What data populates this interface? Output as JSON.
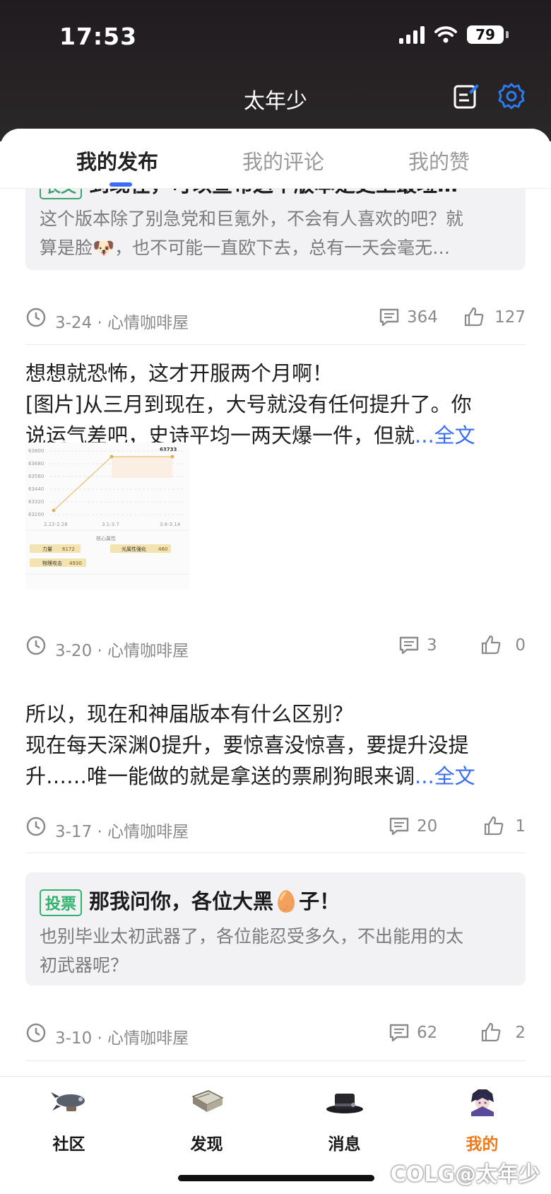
{
  "status_bar": {
    "time": "17:53",
    "battery": "79"
  },
  "header": {
    "title": "太年少"
  },
  "tabs": [
    {
      "label": "我的发布",
      "active": true
    },
    {
      "label": "我的评论",
      "active": false
    },
    {
      "label": "我的赞",
      "active": false
    }
  ],
  "posts": [
    {
      "tag": "长文",
      "title": "到现在，可以宣布这个版本是史上最垃…",
      "body_line1": "这个版本除了别急党和巨氪外，不会有人喜欢的吧？就",
      "body_line2_a": "算是脸",
      "body_line2_b": "，也不可能一直欧下去，总有一天会毫无…",
      "date": "3-24",
      "board": "心情咖啡屋",
      "comments": "364",
      "likes": "127"
    },
    {
      "line1": "想想就恐怖，这才开服两个月啊！",
      "line2": "[图片]从三月到现在，大号就没有任何提升了。你",
      "line3": "说运气差吧，史诗平均一两天爆一件，但就",
      "more": "...全文",
      "date": "3-20",
      "board": "心情咖啡屋",
      "comments": "3",
      "likes": "0",
      "image": {
        "y_ticks": [
          "63800",
          "63680",
          "63560",
          "63440",
          "63320",
          "63200"
        ],
        "x_ticks": [
          "2.22-2.28",
          "3.1-3.7",
          "3.8-3.14"
        ],
        "peak_label": "63733",
        "caption": "核心属性",
        "stats": [
          {
            "name": "力量",
            "value": "6172"
          },
          {
            "name": "光属性强化",
            "value": "460"
          },
          {
            "name": "物理攻击",
            "value": "4930"
          }
        ]
      }
    },
    {
      "line1": "所以，现在和神届版本有什么区别？",
      "line2": "现在每天深渊0提升，要惊喜没惊喜，要提升没提",
      "line3": "升……唯一能做的就是拿送的票刷狗眼来调",
      "more": "...全文",
      "date": "3-17",
      "board": "心情咖啡屋",
      "comments": "20",
      "likes": "1"
    },
    {
      "tag": "投票",
      "title_a": "那我问你，各位大黑",
      "title_b": "子！",
      "body_line1": "也别毕业太初武器了，各位能忍受多久，不出能用的太",
      "body_line2": "初武器呢？",
      "date": "3-10",
      "board": "心情咖啡屋",
      "comments": "62",
      "likes": "2"
    }
  ],
  "bottom_nav": [
    {
      "label": "社区",
      "icon": "airship-icon"
    },
    {
      "label": "发现",
      "icon": "book-icon"
    },
    {
      "label": "消息",
      "icon": "top-hat-icon"
    },
    {
      "label": "我的",
      "icon": "avatar-icon",
      "active": true
    }
  ],
  "watermark": "COLG@太年少",
  "colors": {
    "accent": "#3a6df0",
    "nav_active": "#f07a1a",
    "tag_long": "#3aa36f",
    "tag_vote": "#2fb36e"
  }
}
